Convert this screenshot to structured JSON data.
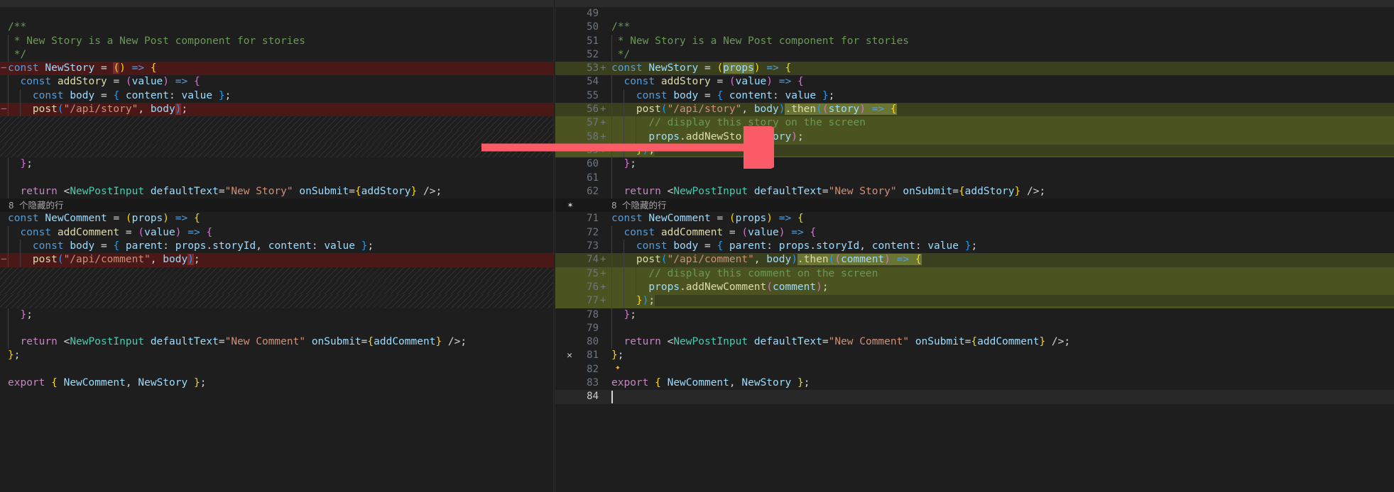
{
  "app": {
    "kind": "vscode-diff-editor"
  },
  "colors": {
    "editor_background": "#1e1e1e",
    "deleted_line_background": "#4b1818",
    "inserted_line_background": "#4b5320",
    "inserted_line_background_dim": "#3a3f1d",
    "inserted_char_highlight": "#6a7534",
    "deleted_char_highlight": "#7a2b2b",
    "line_number_foreground": "#6e7681",
    "active_line_number_foreground": "#cccccc",
    "fold_band_background": "#181818",
    "annotation_arrow": "#fb5a67"
  },
  "fold_separator": {
    "label": "8 个隐藏的行",
    "unfold_icon": "unfold-icon"
  },
  "left_pane": {
    "name": "original-version",
    "rows": [
      {
        "type": "blank",
        "marker": "",
        "text": ""
      },
      {
        "type": "normal",
        "marker": "",
        "text": "/**"
      },
      {
        "type": "normal",
        "marker": "",
        "text": " * New Story is a New Post component for stories"
      },
      {
        "type": "normal",
        "marker": "",
        "text": " */"
      },
      {
        "type": "deleted",
        "marker": "-",
        "text": "const NewStory = () => {"
      },
      {
        "type": "normal",
        "marker": "",
        "text": "  const addStory = (value) => {"
      },
      {
        "type": "normal",
        "marker": "",
        "text": "    const body = { content: value };"
      },
      {
        "type": "deleted",
        "marker": "-",
        "text": "    post(\"/api/story\", body);"
      },
      {
        "type": "hatch",
        "marker": "",
        "text": ""
      },
      {
        "type": "hatch",
        "marker": "",
        "text": ""
      },
      {
        "type": "hatch",
        "marker": "",
        "text": ""
      },
      {
        "type": "normal",
        "marker": "",
        "text": "  };"
      },
      {
        "type": "normal",
        "marker": "",
        "text": ""
      },
      {
        "type": "normal",
        "marker": "",
        "text": "  return <NewPostInput defaultText=\"New Story\" onSubmit={addStory} />;"
      },
      {
        "type": "fold",
        "marker": "",
        "text": "8 个隐藏的行"
      },
      {
        "type": "normal",
        "marker": "",
        "text": "const NewComment = (props) => {"
      },
      {
        "type": "normal",
        "marker": "",
        "text": "  const addComment = (value) => {"
      },
      {
        "type": "normal",
        "marker": "",
        "text": "    const body = { parent: props.storyId, content: value };"
      },
      {
        "type": "deleted",
        "marker": "-",
        "text": "    post(\"/api/comment\", body);"
      },
      {
        "type": "hatch",
        "marker": "",
        "text": ""
      },
      {
        "type": "hatch",
        "marker": "",
        "text": ""
      },
      {
        "type": "hatch",
        "marker": "",
        "text": ""
      },
      {
        "type": "normal",
        "marker": "",
        "text": "  };"
      },
      {
        "type": "normal",
        "marker": "",
        "text": ""
      },
      {
        "type": "normal",
        "marker": "",
        "text": "  return <NewPostInput defaultText=\"New Comment\" onSubmit={addComment} />;"
      },
      {
        "type": "normal",
        "marker": "",
        "text": "};"
      },
      {
        "type": "normal",
        "marker": "",
        "text": ""
      },
      {
        "type": "normal",
        "marker": "",
        "text": "export { NewComment, NewStory };"
      }
    ]
  },
  "right_pane": {
    "name": "modified-version",
    "rows": [
      {
        "line": "49",
        "sign": "",
        "type": "normal",
        "text": ""
      },
      {
        "line": "50",
        "sign": "",
        "type": "normal",
        "text": "/**"
      },
      {
        "line": "51",
        "sign": "",
        "type": "normal",
        "text": " * New Story is a New Post component for stories"
      },
      {
        "line": "52",
        "sign": "",
        "type": "normal",
        "text": " */"
      },
      {
        "line": "53",
        "sign": "+",
        "type": "added",
        "text": "const NewStory = (props) => {"
      },
      {
        "line": "54",
        "sign": "",
        "type": "normal",
        "text": "  const addStory = (value) => {"
      },
      {
        "line": "55",
        "sign": "",
        "type": "normal",
        "text": "    const body = { content: value };"
      },
      {
        "line": "56",
        "sign": "+",
        "type": "added",
        "text": "    post(\"/api/story\", body).then((story) => {"
      },
      {
        "line": "57",
        "sign": "+",
        "type": "added",
        "text": "      // display this story on the screen"
      },
      {
        "line": "58",
        "sign": "+",
        "type": "added",
        "text": "      props.addNewStory(story);"
      },
      {
        "line": "59",
        "sign": "+",
        "type": "added",
        "text": "    });"
      },
      {
        "line": "60",
        "sign": "",
        "type": "normal",
        "text": "  };"
      },
      {
        "line": "61",
        "sign": "",
        "type": "normal",
        "text": ""
      },
      {
        "line": "62",
        "sign": "",
        "type": "normal",
        "text": "  return <NewPostInput defaultText=\"New Story\" onSubmit={addStory} />;"
      },
      {
        "line": "",
        "sign": "",
        "type": "fold",
        "text": "8 个隐藏的行"
      },
      {
        "line": "71",
        "sign": "",
        "type": "normal",
        "text": "const NewComment = (props) => {"
      },
      {
        "line": "72",
        "sign": "",
        "type": "normal",
        "text": "  const addComment = (value) => {"
      },
      {
        "line": "73",
        "sign": "",
        "type": "normal",
        "text": "    const body = { parent: props.storyId, content: value };"
      },
      {
        "line": "74",
        "sign": "+",
        "type": "added",
        "text": "    post(\"/api/comment\", body).then((comment) => {"
      },
      {
        "line": "75",
        "sign": "+",
        "type": "added",
        "text": "      // display this comment on the screen"
      },
      {
        "line": "76",
        "sign": "+",
        "type": "added",
        "text": "      props.addNewComment(comment);"
      },
      {
        "line": "77",
        "sign": "+",
        "type": "added",
        "text": "    });"
      },
      {
        "line": "78",
        "sign": "",
        "type": "normal",
        "text": "  };"
      },
      {
        "line": "79",
        "sign": "",
        "type": "normal",
        "text": ""
      },
      {
        "line": "80",
        "sign": "",
        "type": "normal",
        "text": "  return <NewPostInput defaultText=\"New Comment\" onSubmit={addComment} />;"
      },
      {
        "line": "81",
        "sign": "",
        "type": "normal",
        "text": "};",
        "gutter_icon": "close-icon"
      },
      {
        "line": "82",
        "sign": "",
        "type": "normal",
        "text": ""
      },
      {
        "line": "83",
        "sign": "",
        "type": "normal",
        "text": "export { NewComment, NewStory };"
      },
      {
        "line": "84",
        "sign": "",
        "type": "current",
        "text": ""
      }
    ]
  }
}
